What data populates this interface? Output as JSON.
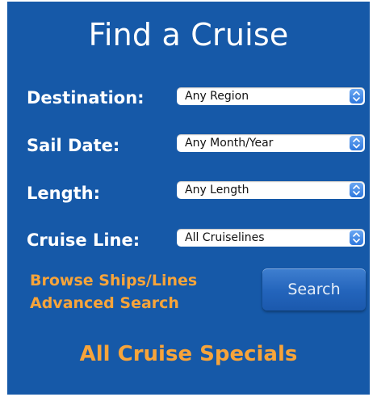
{
  "title": "Find a Cruise",
  "fields": {
    "destination": {
      "label": "Destination:",
      "value": "Any Region"
    },
    "sail_date": {
      "label": "Sail Date:",
      "value": "Any Month/Year"
    },
    "length": {
      "label": "Length:",
      "value": "Any Length"
    },
    "cruise_line": {
      "label": "Cruise Line:",
      "value": "All Cruiselines"
    }
  },
  "links": {
    "browse": "Browse Ships/Lines",
    "advanced": "Advanced Search",
    "specials": "All Cruise Specials"
  },
  "search_button": "Search",
  "icons": {
    "select_arrows": "chevron-up-down-icon"
  },
  "colors": {
    "panel_background": "#1659a8",
    "link_orange": "#f7a43a",
    "button_blue": "#2364bb",
    "select_arrow_blue": "#3f86e6"
  }
}
